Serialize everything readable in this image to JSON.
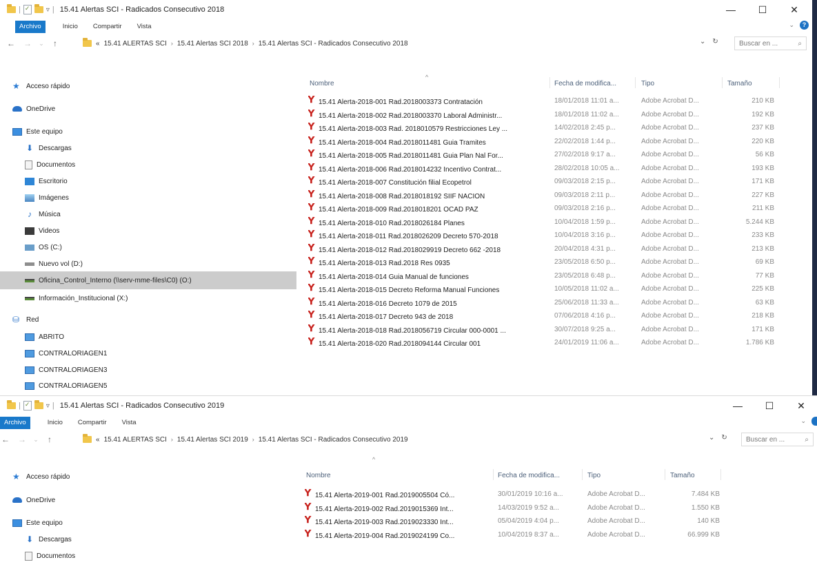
{
  "window1": {
    "title": "15.41 Alertas SCI - Radicados Consecutivo 2018",
    "ribbon_tabs": [
      "Archivo",
      "Inicio",
      "Compartir",
      "Vista"
    ],
    "window_controls": [
      "—",
      "☐",
      "✕"
    ],
    "address": {
      "prefix": "«",
      "crumbs": [
        "15.41 ALERTAS SCI",
        "15.41 Alertas SCI 2018",
        "15.41 Alertas SCI - Radicados Consecutivo 2018"
      ],
      "separator": "›",
      "refresh": "↻",
      "dropdown": "⌄",
      "search_placeholder": "Buscar en ...",
      "search_icon": "⌕"
    },
    "nav": [
      {
        "label": "Acceso rápido",
        "icon": "star-icon"
      },
      {
        "label": "OneDrive",
        "icon": "cloud-icon"
      },
      {
        "label": "Este equipo",
        "icon": "computer-icon"
      },
      {
        "label": "Descargas",
        "icon": "download-icon"
      },
      {
        "label": "Documentos",
        "icon": "document-icon"
      },
      {
        "label": "Escritorio",
        "icon": "desktop-icon"
      },
      {
        "label": "Imágenes",
        "icon": "pictures-icon"
      },
      {
        "label": "Música",
        "icon": "music-icon"
      },
      {
        "label": "Videos",
        "icon": "video-icon"
      },
      {
        "label": "OS (C:)",
        "icon": "os-drive-icon"
      },
      {
        "label": "Nuevo vol (D:)",
        "icon": "drive-icon"
      },
      {
        "label": "Oficina_Control_Interno (\\\\serv-mme-files\\C0) (O:)",
        "icon": "network-drive-icon"
      },
      {
        "label": "Información_Institucional (X:)",
        "icon": "network-drive-icon"
      },
      {
        "label": "Red",
        "icon": "network-icon"
      },
      {
        "label": "ABRITO",
        "icon": "computer-icon"
      },
      {
        "label": "CONTRALORIAGEN1",
        "icon": "computer-icon"
      },
      {
        "label": "CONTRALORIAGEN3",
        "icon": "computer-icon"
      },
      {
        "label": "CONTRALORIAGEN5",
        "icon": "computer-icon"
      }
    ],
    "columns": {
      "name": "Nombre",
      "date": "Fecha de modifica...",
      "type": "Tipo",
      "size": "Tamaño"
    },
    "files": [
      {
        "name": "15.41 Alerta-2018-001 Rad.2018003373 Contratación",
        "date": "18/01/2018 11:01 a...",
        "type": "Adobe Acrobat D...",
        "size": "210 KB"
      },
      {
        "name": "15.41 Alerta-2018-002 Rad.2018003370 Laboral Administr...",
        "date": "18/01/2018 11:02 a...",
        "type": "Adobe Acrobat D...",
        "size": "192 KB"
      },
      {
        "name": "15.41 Alerta-2018-003 Rad. 2018010579 Restricciones Ley ...",
        "date": "14/02/2018 2:45 p...",
        "type": "Adobe Acrobat D...",
        "size": "237 KB"
      },
      {
        "name": "15.41 Alerta-2018-004 Rad.2018011481 Guia Tramites",
        "date": "22/02/2018 1:44 p...",
        "type": "Adobe Acrobat D...",
        "size": "220 KB"
      },
      {
        "name": "15.41 Alerta-2018-005 Rad.2018011481 Guia Plan Nal For...",
        "date": "27/02/2018 9:17 a...",
        "type": "Adobe Acrobat D...",
        "size": "56 KB"
      },
      {
        "name": "15.41 Alerta-2018-006 Rad.2018014232 Incentivo Contrat...",
        "date": "28/02/2018 10:05 a...",
        "type": "Adobe Acrobat D...",
        "size": "193 KB"
      },
      {
        "name": "15.41 Alerta-2018-007 Constitución filial Ecopetrol",
        "date": "09/03/2018 2:15 p...",
        "type": "Adobe Acrobat D...",
        "size": "171 KB"
      },
      {
        "name": "15.41 Alerta-2018-008 Rad.2018018192 SIIF NACION",
        "date": "09/03/2018 2:11 p...",
        "type": "Adobe Acrobat D...",
        "size": "227 KB"
      },
      {
        "name": "15.41 Alerta-2018-009 Rad.2018018201 OCAD PAZ",
        "date": "09/03/2018 2:16 p...",
        "type": "Adobe Acrobat D...",
        "size": "211 KB"
      },
      {
        "name": "15.41 Alerta-2018-010 Rad.2018026184 Planes",
        "date": "10/04/2018 1:59 p...",
        "type": "Adobe Acrobat D...",
        "size": "5.244 KB"
      },
      {
        "name": "15.41 Alerta-2018-011 Rad.2018026209 Decreto 570-2018",
        "date": "10/04/2018 3:16 p...",
        "type": "Adobe Acrobat D...",
        "size": "233 KB"
      },
      {
        "name": "15.41 Alerta-2018-012 Rad.2018029919 Decreto 662 -2018",
        "date": "20/04/2018 4:31 p...",
        "type": "Adobe Acrobat D...",
        "size": "213 KB"
      },
      {
        "name": "15.41 Alerta-2018-013 Rad.2018 Res 0935",
        "date": "23/05/2018 6:50 p...",
        "type": "Adobe Acrobat D...",
        "size": "69 KB"
      },
      {
        "name": "15.41 Alerta-2018-014 Guia Manual de funciones",
        "date": "23/05/2018 6:48 p...",
        "type": "Adobe Acrobat D...",
        "size": "77 KB"
      },
      {
        "name": "15.41 Alerta-2018-015 Decreto Reforma Manual Funciones",
        "date": "10/05/2018 11:02 a...",
        "type": "Adobe Acrobat D...",
        "size": "225 KB"
      },
      {
        "name": "15.41 Alerta-2018-016 Decreto 1079 de 2015",
        "date": "25/06/2018 11:33 a...",
        "type": "Adobe Acrobat D...",
        "size": "63 KB"
      },
      {
        "name": "15.41 Alerta-2018-017 Decreto 943 de 2018",
        "date": "07/06/2018 4:16 p...",
        "type": "Adobe Acrobat D...",
        "size": "218 KB"
      },
      {
        "name": "15.41 Alerta-2018-018 Rad.2018056719 Circular 000-0001 ...",
        "date": "30/07/2018 9:25 a...",
        "type": "Adobe Acrobat D...",
        "size": "171 KB"
      },
      {
        "name": "15.41 Alerta-2018-020 Rad.2018094144 Circular 001",
        "date": "24/01/2019 11:06 a...",
        "type": "Adobe Acrobat D...",
        "size": "1.786 KB"
      }
    ]
  },
  "window2": {
    "title": "15.41 Alertas SCI - Radicados Consecutivo 2019",
    "ribbon_tabs": [
      "Archivo",
      "Inicio",
      "Compartir",
      "Vista"
    ],
    "window_controls": [
      "—",
      "☐",
      "✕"
    ],
    "address": {
      "prefix": "«",
      "crumbs": [
        "15.41 ALERTAS SCI",
        "15.41 Alertas SCI 2019",
        "15.41 Alertas SCI - Radicados Consecutivo 2019"
      ],
      "separator": "›",
      "refresh": "↻",
      "dropdown": "⌄",
      "search_placeholder": "Buscar en ...",
      "search_icon": "⌕"
    },
    "nav": [
      {
        "label": "Acceso rápido",
        "icon": "star-icon"
      },
      {
        "label": "OneDrive",
        "icon": "cloud-icon"
      },
      {
        "label": "Este equipo",
        "icon": "computer-icon"
      },
      {
        "label": "Descargas",
        "icon": "download-icon"
      },
      {
        "label": "Documentos",
        "icon": "document-icon"
      }
    ],
    "columns": {
      "name": "Nombre",
      "date": "Fecha de modifica...",
      "type": "Tipo",
      "size": "Tamaño"
    },
    "files": [
      {
        "name": "15.41 Alerta-2019-001 Rad.2019005504 Có...",
        "date": "30/01/2019 10:16 a...",
        "type": "Adobe Acrobat D...",
        "size": "7.484 KB"
      },
      {
        "name": "15.41 Alerta-2019-002 Rad.2019015369 Int...",
        "date": "14/03/2019 9:52 a...",
        "type": "Adobe Acrobat D...",
        "size": "1.550 KB"
      },
      {
        "name": "15.41 Alerta-2019-003 Rad.2019023330 Int...",
        "date": "05/04/2019 4:04 p...",
        "type": "Adobe Acrobat D...",
        "size": "140 KB"
      },
      {
        "name": "15.41 Alerta-2019-004 Rad.2019024199 Co...",
        "date": "10/04/2019 8:37 a...",
        "type": "Adobe Acrobat D...",
        "size": "66.999 KB"
      }
    ]
  }
}
